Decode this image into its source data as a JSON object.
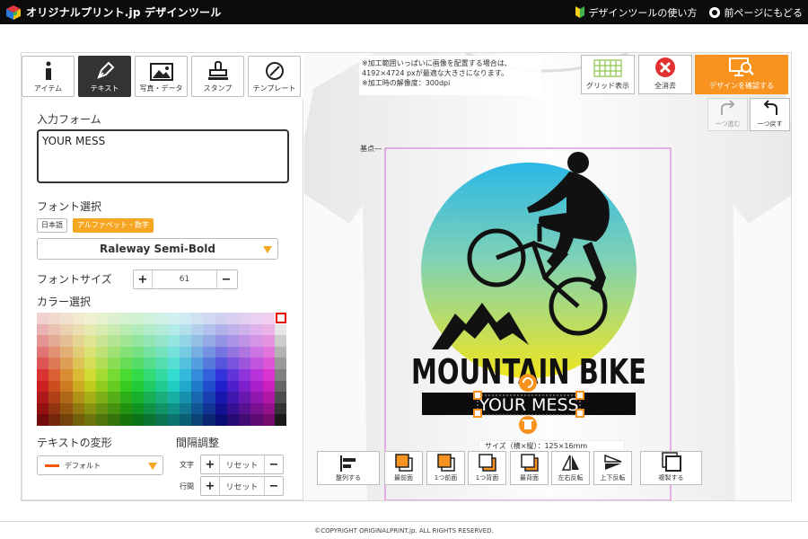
{
  "header": {
    "logo_text": "オリジナルプリント.jp デザインツール",
    "help_link": "デザインツールの使い方",
    "back_link": "前ページにもどる"
  },
  "tabs": [
    {
      "label": "アイテム",
      "icon": "info-icon"
    },
    {
      "label": "テキスト",
      "icon": "pen-icon",
      "active": true
    },
    {
      "label": "写真・データ",
      "icon": "image-icon"
    },
    {
      "label": "スタンプ",
      "icon": "stamp-icon"
    },
    {
      "label": "テンプレート",
      "icon": "compass-icon"
    }
  ],
  "text_form": {
    "input_label": "入力フォーム",
    "input_value": "YOUR MESS",
    "font_label": "フォント選択",
    "lang_japanese": "日本語",
    "lang_alpha": "アルファベット・数字",
    "font_value": "Raleway Semi-Bold",
    "size_label": "フォントサイズ",
    "size_value": "61",
    "color_label": "カラー選択",
    "transform_label": "テキストの変形",
    "transform_value": "デフォルト",
    "spacing_label": "間隔調整",
    "char_label": "文字",
    "line_label": "行間",
    "reset_label": "リセット"
  },
  "notice": {
    "line1": "※加工範囲いっぱいに画像を配置する場合は、",
    "line2": "4192×4724 pxが最適な大きさになります。",
    "line3": "※加工時の解像度：300dpi"
  },
  "toolbar": {
    "grid": "グリッド表示",
    "clear": "全消去",
    "confirm": "デザインを確認する",
    "redo": "一つ進む",
    "undo": "一つ戻す"
  },
  "canvas": {
    "origin_label": "基点",
    "design_title": "MOUNTAIN BIKE",
    "design_message": "YOUR MESS",
    "size_text": "サイズ（横×縦）：125×16mm"
  },
  "bottom_tools": {
    "align": "整列する",
    "front": "最前面",
    "forward": "1つ前面",
    "backward": "1つ背面",
    "back": "最背面",
    "flip_h": "左右反転",
    "flip_v": "上下反転",
    "duplicate": "複製する"
  },
  "footer": {
    "copyright": "©COPYRIGHT ORIGINALPRINT.jp. ALL RIGHTS RESERVED."
  },
  "colors": {
    "accent_orange": "#f7931e",
    "clear_red": "#e03030",
    "topbar": "#0c0c0c"
  }
}
